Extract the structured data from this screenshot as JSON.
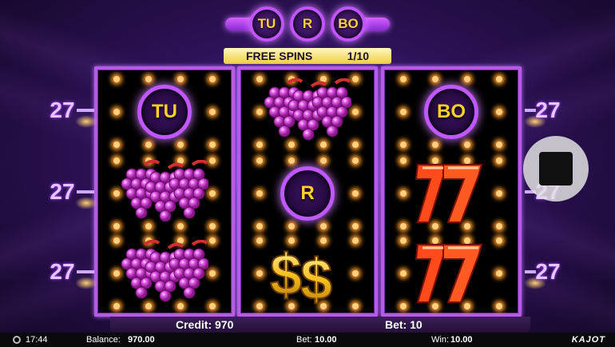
{
  "logo": {
    "letters": [
      "TU",
      "R",
      "BO"
    ]
  },
  "free_spins": {
    "label": "FREE SPINS",
    "count": "1/10"
  },
  "reels": [
    {
      "symbols": [
        {
          "type": "ring",
          "text": "TU"
        },
        {
          "type": "grapes"
        },
        {
          "type": "grapes"
        }
      ]
    },
    {
      "symbols": [
        {
          "type": "grapes"
        },
        {
          "type": "ring",
          "text": "R"
        },
        {
          "type": "dollar"
        }
      ]
    },
    {
      "symbols": [
        {
          "type": "ring",
          "text": "BO"
        },
        {
          "type": "seven"
        },
        {
          "type": "seven"
        }
      ]
    }
  ],
  "paylines": {
    "left": [
      "27",
      "27",
      "27"
    ],
    "right": [
      "27",
      "27",
      "27"
    ]
  },
  "bottom": {
    "credit": "Credit: 970",
    "bet": "Bet: 10"
  },
  "status": {
    "time": "17:44",
    "balance_label": "Balance:",
    "balance_value": "970.00",
    "bet_label": "Bet:",
    "bet_value": "10.00",
    "win_label": "Win:",
    "win_value": "10.00",
    "brand": "KAJOT"
  },
  "colors": {
    "reel_frame": "#b85ae8",
    "ring": "#c157ff",
    "ring_text": "#ffcf2a",
    "free_spins_bar": "#f0d040"
  },
  "icons": {
    "stop": "stop-icon",
    "clock": "clock-icon"
  }
}
